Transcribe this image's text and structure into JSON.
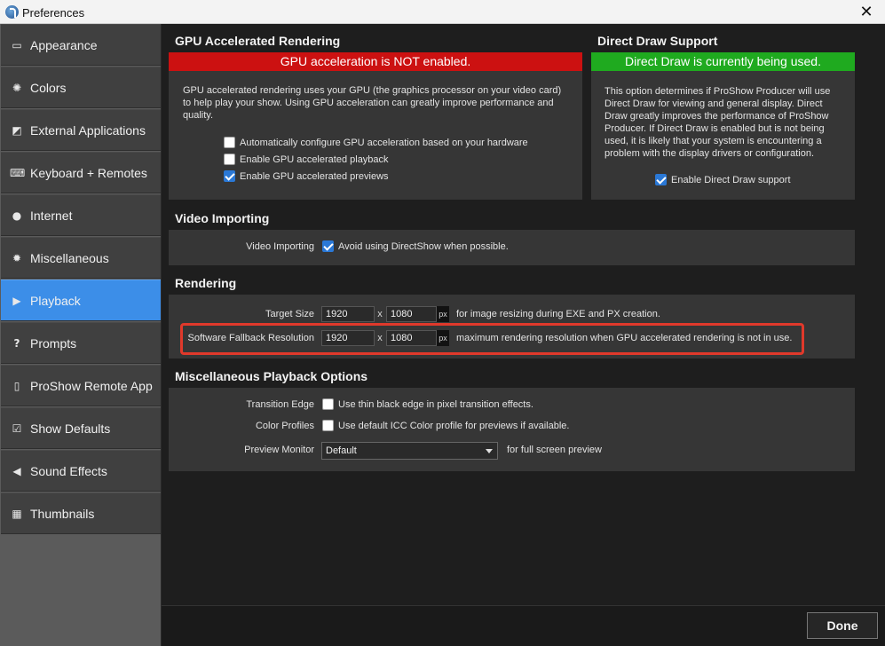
{
  "window": {
    "title": "Preferences",
    "close_glyph": "✕"
  },
  "sidebar": {
    "items": [
      {
        "label": "Appearance",
        "icon": "window-icon",
        "glyph": "▭"
      },
      {
        "label": "Colors",
        "icon": "palette-icon",
        "glyph": "✺"
      },
      {
        "label": "External Applications",
        "icon": "external-window-icon",
        "glyph": "◩"
      },
      {
        "label": "Keyboard + Remotes",
        "icon": "keyboard-icon",
        "glyph": "⌨"
      },
      {
        "label": "Internet",
        "icon": "globe-icon",
        "glyph": "●"
      },
      {
        "label": "Miscellaneous",
        "icon": "gear-icon",
        "glyph": "✹"
      },
      {
        "label": "Playback",
        "icon": "play-icon",
        "glyph": "▶"
      },
      {
        "label": "Prompts",
        "icon": "question-icon",
        "glyph": "?"
      },
      {
        "label": "ProShow Remote App",
        "icon": "remote-icon",
        "glyph": "▯"
      },
      {
        "label": "Show Defaults",
        "icon": "checkbox-icon",
        "glyph": "☑"
      },
      {
        "label": "Sound Effects",
        "icon": "speaker-icon",
        "glyph": "◀"
      },
      {
        "label": "Thumbnails",
        "icon": "thumbnail-icon",
        "glyph": "▦"
      }
    ],
    "active_index": 6
  },
  "gpu": {
    "title": "GPU Accelerated Rendering",
    "status": "GPU acceleration is NOT enabled.",
    "status_color": "#cc1111",
    "description": "GPU accelerated rendering uses your GPU (the graphics processor on your video card) to help play your show. Using GPU acceleration can greatly improve performance and quality.",
    "options": [
      {
        "label": "Automatically configure GPU acceleration based on your hardware",
        "checked": false
      },
      {
        "label": "Enable GPU accelerated playback",
        "checked": false
      },
      {
        "label": "Enable GPU accelerated previews",
        "checked": true
      }
    ]
  },
  "direct_draw": {
    "title": "Direct Draw Support",
    "status": "Direct Draw is currently being used.",
    "status_color": "#1faa1f",
    "description": "This option determines if ProShow Producer will use Direct Draw for viewing and general display. Direct Draw greatly improves the performance of ProShow Producer. If Direct Draw is enabled but is not being used, it is likely that your system is encountering a problem with the display drivers or configuration.",
    "option": {
      "label": "Enable Direct Draw support",
      "checked": true
    }
  },
  "video_importing": {
    "title": "Video Importing",
    "row_label": "Video Importing",
    "option": {
      "label": "Avoid using DirectShow when possible.",
      "checked": true
    }
  },
  "rendering": {
    "title": "Rendering",
    "target": {
      "label": "Target Size",
      "width": "1920",
      "height": "1080",
      "x": "x",
      "unit": "px",
      "note": "for image resizing during EXE and PX creation."
    },
    "fallback": {
      "label": "Software Fallback Resolution",
      "width": "1920",
      "height": "1080",
      "x": "x",
      "unit": "px",
      "note": "maximum rendering resolution when GPU accelerated rendering is not in use."
    },
    "highlight_color": "#e0392b"
  },
  "misc_playback": {
    "title": "Miscellaneous Playback Options",
    "transition": {
      "label": "Transition Edge",
      "option": "Use thin black edge in pixel transition effects.",
      "checked": false
    },
    "color_profiles": {
      "label": "Color Profiles",
      "option": "Use default ICC Color profile for previews if available.",
      "checked": false
    },
    "preview_monitor": {
      "label": "Preview Monitor",
      "value": "Default",
      "note": "for full screen preview"
    }
  },
  "footer": {
    "done_label": "Done"
  },
  "colors": {
    "accent": "#3c8ee8",
    "panel": "#363636",
    "background": "#1e1e1e"
  }
}
